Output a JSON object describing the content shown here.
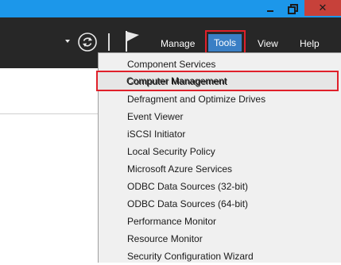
{
  "window": {
    "minimize_icon": "minimize-icon",
    "maximize_icon": "restore-icon",
    "close_icon": "close-icon",
    "close_glyph": "✕",
    "titlebar_color": "#1c97ea",
    "close_color": "#c7413a"
  },
  "toolbar": {
    "background": "#272727",
    "refresh_icon": "refresh-icon",
    "flag_icon": "notifications-flag-icon",
    "menus": {
      "manage": "Manage",
      "tools": "Tools",
      "view": "View",
      "help": "Help"
    },
    "active_menu_color": "#3a7fc5"
  },
  "tools_menu": {
    "items": [
      "Component Services",
      "Computer Management",
      "Defragment and Optimize Drives",
      "Event Viewer",
      "iSCSI Initiator",
      "Local Security Policy",
      "Microsoft Azure Services",
      "ODBC Data Sources (32-bit)",
      "ODBC Data Sources (64-bit)",
      "Performance Monitor",
      "Resource Monitor",
      "Security Configuration Wizard"
    ],
    "highlighted_item": "Computer Management"
  },
  "annotation_color": "#e0202a"
}
